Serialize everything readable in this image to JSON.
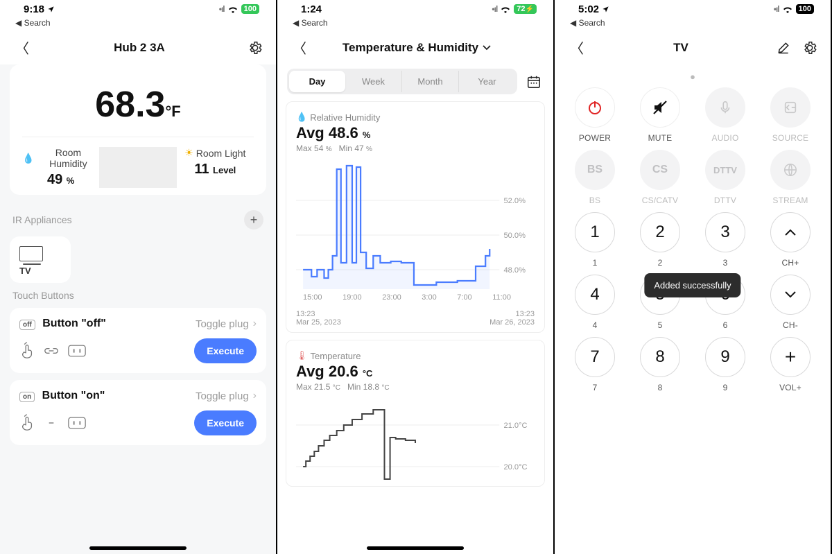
{
  "pane1": {
    "status": {
      "time": "9:18",
      "signal": "•ıl",
      "wifi": "􀙇",
      "battery": "100",
      "back_label": "Search"
    },
    "title": "Hub 2 3A",
    "temp_value": "68.3",
    "temp_unit": "°F",
    "humidity_label": "Room Humidity",
    "humidity_value": "49",
    "humidity_unit": "%",
    "light_label": "Room Light",
    "light_value": "11",
    "light_unit": "Level",
    "ir_section": "IR Appliances",
    "tv_label": "TV",
    "touch_section": "Touch Buttons",
    "buttons": [
      {
        "badge": "off",
        "name": "Button \"off\"",
        "action": "Toggle plug",
        "exec": "Execute"
      },
      {
        "badge": "on",
        "name": "Button \"on\"",
        "action": "Toggle plug",
        "exec": "Execute"
      }
    ]
  },
  "pane2": {
    "status": {
      "time": "1:24",
      "signal": "•ıl",
      "wifi": "􀙇",
      "battery": "72",
      "back_label": "Search"
    },
    "title": "Temperature & Humidity",
    "segments": [
      "Day",
      "Week",
      "Month",
      "Year"
    ],
    "segment_active": 0,
    "humidity_card": {
      "label": "Relative Humidity",
      "avg_label": "Avg",
      "avg_value": "48.6",
      "avg_unit": "%",
      "max_label": "Max",
      "max_value": "54",
      "max_unit": "%",
      "min_label": "Min",
      "min_value": "47",
      "min_unit": "%",
      "yticks": [
        "52.0%",
        "50.0%",
        "48.0%"
      ],
      "xticks": [
        "15:00",
        "19:00",
        "23:00",
        "3:00",
        "7:00",
        "11:00"
      ],
      "start_time": "13:23",
      "start_date": "Mar 25, 2023",
      "end_time": "13:23",
      "end_date": "Mar 26, 2023"
    },
    "temp_card": {
      "label": "Temperature",
      "avg_label": "Avg",
      "avg_value": "20.6",
      "avg_unit": "°C",
      "max_label": "Max",
      "max_value": "21.5",
      "max_unit": "°C",
      "min_label": "Min",
      "min_value": "18.8",
      "min_unit": "°C",
      "yticks": [
        "21.0°C",
        "20.0°C"
      ]
    }
  },
  "pane3": {
    "status": {
      "time": "5:02",
      "signal": "•ıl",
      "wifi": "􀙇",
      "battery": "100",
      "back_label": "Search"
    },
    "title": "TV",
    "tooltip": "Added successfully",
    "row1": [
      {
        "label": "POWER",
        "icon": "power"
      },
      {
        "label": "MUTE",
        "icon": "mute"
      },
      {
        "label": "AUDIO",
        "icon": "mic",
        "dim": true
      },
      {
        "label": "SOURCE",
        "icon": "source",
        "dim": true
      }
    ],
    "row2": [
      {
        "label": "BS",
        "text": "BS",
        "dim": true
      },
      {
        "label": "CS/CATV",
        "text": "CS",
        "dim": true
      },
      {
        "label": "DTTV",
        "text": "DTTV",
        "dim": true
      },
      {
        "label": "STREAM",
        "icon": "globe",
        "dim": true
      }
    ],
    "row3": [
      {
        "num": "1",
        "label": "1"
      },
      {
        "num": "2",
        "label": "2"
      },
      {
        "num": "3",
        "label": "3"
      },
      {
        "icon": "up",
        "label": "CH+"
      }
    ],
    "row4": [
      {
        "num": "4",
        "label": "4"
      },
      {
        "num": "5",
        "label": "5"
      },
      {
        "num": "6",
        "label": "6"
      },
      {
        "icon": "down",
        "label": "CH-"
      }
    ],
    "row5": [
      {
        "num": "7",
        "label": "7"
      },
      {
        "num": "8",
        "label": "8"
      },
      {
        "num": "9",
        "label": "9"
      },
      {
        "icon": "plus",
        "label": "VOL+"
      }
    ]
  },
  "chart_data": [
    {
      "type": "line",
      "title": "Relative Humidity",
      "ylabel": "%",
      "ylim": [
        47,
        53
      ],
      "x": [
        "13:23",
        "15:00",
        "17:00",
        "18:00",
        "19:00",
        "19:30",
        "20:00",
        "20:30",
        "21:00",
        "21:30",
        "22:00",
        "22:30",
        "23:00",
        "23:30",
        "0:00",
        "1:00",
        "3:00",
        "5:00",
        "6:00",
        "7:00",
        "8:00",
        "10:00",
        "11:00",
        "12:00",
        "13:23"
      ],
      "values": [
        48,
        48,
        48,
        47,
        48,
        49,
        52.5,
        48.5,
        52.7,
        48.5,
        52.6,
        49,
        48.5,
        49.2,
        48.7,
        49,
        48.9,
        48.7,
        48,
        47,
        47,
        47,
        47.3,
        48.3,
        48.5
      ]
    },
    {
      "type": "line",
      "title": "Temperature",
      "ylabel": "°C",
      "ylim": [
        18.5,
        22
      ],
      "x": [
        "13:23",
        "15:00",
        "16:00",
        "17:00",
        "18:00",
        "19:00",
        "20:00",
        "21:00",
        "22:00",
        "23:00",
        "0:00",
        "1:00",
        "2:00"
      ],
      "values": [
        19.8,
        20.4,
        20.6,
        20.8,
        21.0,
        21.2,
        21.4,
        21.4,
        18.8,
        20.6,
        20.5,
        20.4,
        20.2
      ]
    }
  ]
}
